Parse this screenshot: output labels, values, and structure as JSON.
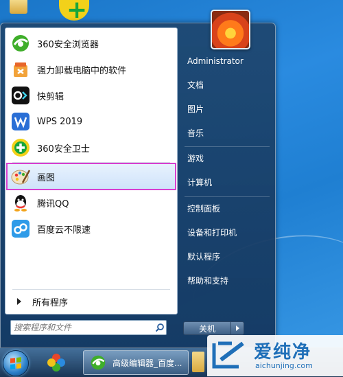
{
  "programs": [
    {
      "label": "360安全浏览器",
      "icon": "360-browser-icon"
    },
    {
      "label": "强力卸载电脑中的软件",
      "icon": "uninstall-icon"
    },
    {
      "label": "快剪辑",
      "icon": "kuaijianji-icon"
    },
    {
      "label": "WPS 2019",
      "icon": "wps-icon"
    },
    {
      "label": "360安全卫士",
      "icon": "360-safe-icon"
    },
    {
      "label": "画图",
      "icon": "paint-icon"
    },
    {
      "label": "腾讯QQ",
      "icon": "qq-icon"
    },
    {
      "label": "百度云不限速",
      "icon": "baidu-cloud-icon"
    }
  ],
  "all_programs": "所有程序",
  "search": {
    "placeholder": "搜索程序和文件"
  },
  "right_items": [
    "Administrator",
    "文档",
    "图片",
    "音乐",
    "游戏",
    "计算机",
    "控制面板",
    "设备和打印机",
    "默认程序",
    "帮助和支持"
  ],
  "shutdown_label": "关机",
  "taskbar": {
    "task_label": "高级编辑器_百度..."
  },
  "watermark": {
    "title": "爱纯净",
    "url": "aichunjing.com"
  },
  "colors": {
    "selection_outline": "#d83fd0",
    "desktop": "#2a8be0"
  }
}
